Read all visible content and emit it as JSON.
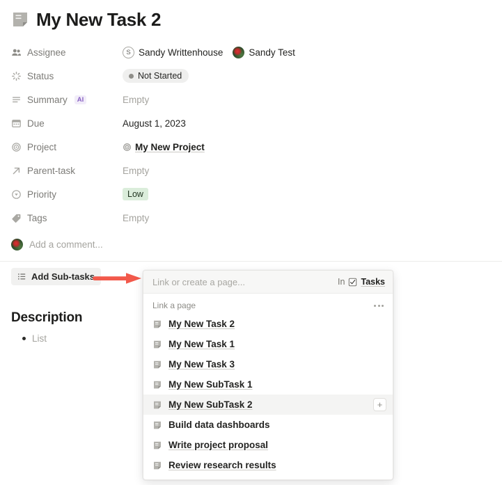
{
  "header": {
    "icon": "page-icon",
    "title": "My New Task 2"
  },
  "properties": [
    {
      "icon": "people-icon",
      "label": "Assignee",
      "type": "people",
      "people": [
        {
          "name": "Sandy Writtenhouse",
          "avatar": "initial",
          "initial": "S"
        },
        {
          "name": "Sandy Test",
          "avatar": "photo"
        }
      ]
    },
    {
      "icon": "status-spinner-icon",
      "label": "Status",
      "type": "status",
      "value": "Not Started"
    },
    {
      "icon": "text-lines-icon",
      "label": "Summary",
      "badge": "AI",
      "type": "empty",
      "value": "Empty"
    },
    {
      "icon": "calendar-icon",
      "label": "Due",
      "type": "text",
      "value": "August 1, 2023"
    },
    {
      "icon": "target-icon",
      "label": "Project",
      "type": "relation",
      "value": "My New Project"
    },
    {
      "icon": "arrow-up-right-icon",
      "label": "Parent-task",
      "type": "empty",
      "value": "Empty"
    },
    {
      "icon": "circle-caret-icon",
      "label": "Priority",
      "type": "tag",
      "value": "Low"
    },
    {
      "icon": "tag-icon",
      "label": "Tags",
      "type": "empty",
      "value": "Empty"
    }
  ],
  "comment": {
    "placeholder": "Add a comment..."
  },
  "subtasks": {
    "button_label": "Add Sub-tasks",
    "button_icon": "list-icon",
    "annotation_icon": "red-arrow-right"
  },
  "description": {
    "heading": "Description",
    "list_item": "List"
  },
  "link_panel": {
    "search_placeholder": "Link or create a page...",
    "in_word": "In",
    "in_database": "Tasks",
    "in_database_icon": "checkbox-checked-icon",
    "section_label": "Link a page",
    "overflow_icon": "ellipsis-icon",
    "add_icon": "plus-icon",
    "items": [
      {
        "label": "My New Task 2",
        "icon": "page-icon",
        "selected": false,
        "underline": true
      },
      {
        "label": "My New Task 1",
        "icon": "page-icon",
        "selected": false,
        "underline": true
      },
      {
        "label": "My New Task 3",
        "icon": "page-icon",
        "selected": false,
        "underline": true
      },
      {
        "label": "My New SubTask 1",
        "icon": "page-icon",
        "selected": false,
        "underline": true
      },
      {
        "label": "My New SubTask 2",
        "icon": "page-icon",
        "selected": true,
        "underline": true
      },
      {
        "label": "Build data dashboards",
        "icon": "page-icon",
        "selected": false,
        "underline": false
      },
      {
        "label": "Write project proposal",
        "icon": "page-icon",
        "selected": false,
        "underline": true
      },
      {
        "label": "Review research results",
        "icon": "page-icon",
        "selected": false,
        "underline": true
      }
    ]
  },
  "colors": {
    "accent_red": "#f2594b",
    "tag_green_bg": "#dbeddb",
    "ai_purple": "#8a63c4",
    "panel_bg": "#ffffff"
  }
}
